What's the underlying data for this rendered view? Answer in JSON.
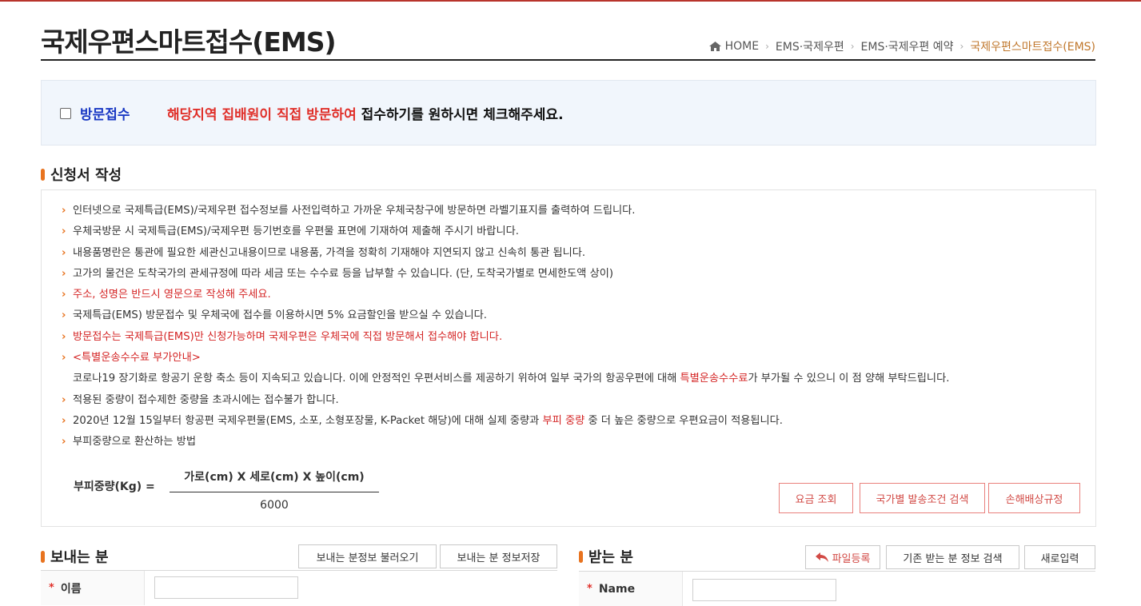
{
  "header": {
    "title": "국제우편스마트접수(EMS)",
    "breadcrumb": {
      "home": "HOME",
      "items": [
        "EMS·국제우편",
        "EMS·국제우편 예약"
      ],
      "current": "국제우편스마트접수(EMS)"
    }
  },
  "visit": {
    "label": "방문접수",
    "desc_red": "해당지역 집배원이 직접 방문하여",
    "desc_rest": " 접수하기를 원하시면 체크해주세요."
  },
  "application": {
    "title": "신청서 작성",
    "items": [
      "인터넷으로 국제특급(EMS)/국제우편 접수정보를 사전입력하고 가까운 우체국창구에 방문하면 라벨기표지를 출력하여 드립니다.",
      "우체국방문 시 국제특급(EMS)/국제우편 등기번호를 우편물 표면에 기재하여 제출해 주시기 바랍니다.",
      "내용품명란은 통관에 필요한 세관신고내용이므로 내용품, 가격을 정확히 기재해야 지연되지 않고 신속히 통관 됩니다.",
      "고가의 물건은 도착국가의 관세규정에 따라 세금 또는 수수료 등을 납부할 수 있습니다. (단, 도착국가별로 면세한도액 상이)",
      "주소, 성명은 반드시 영문으로 작성해 주세요.",
      "국제특급(EMS) 방문접수 및 우체국에 접수를 이용하시면 5% 요금할인을 받으실 수 있습니다.",
      "방문접수는 국제특급(EMS)만 신청가능하며 국제우편은 우체국에 직접 방문해서 접수해야 합니다.",
      "<특별운송수수료 부가안내>"
    ],
    "surcharge": {
      "before": "코로나19 장기화로 항공기 운항 축소 등이 지속되고 있습니다. 이에 안정적인 우편서비스를 제공하기 위하여 일부 국가의 항공우편에 대해 ",
      "red": "특별운송수수료",
      "after": "가 부가될 수 있으니 이 점 양해 부탁드립니다."
    },
    "item_weight_limit": "적용된 중량이 접수제한 중량을 초과시에는 접수불가 합니다.",
    "volume": {
      "before": "2020년 12월 15일부터 항공편 국제우편물(EMS, 소포, 소형포장물, K-Packet 해당)에 대해 실제 중량과 ",
      "red": "부피 중량",
      "after": " 중 더 높은 중량으로 우편요금이 적용됩니다."
    },
    "item_volume_method": "부피중량으로 환산하는 방법",
    "formula": {
      "label": "부피중량(Kg) =",
      "numerator": "가로(cm) X 세로(cm) X 높이(cm)",
      "denominator": "6000"
    },
    "buttons": {
      "fee": "요금 조회",
      "country": "국가별 발송조건 검색",
      "damage": "손해배상규정"
    }
  },
  "sender": {
    "title": "보내는 분",
    "load_button": "보내는 분정보 불러오기",
    "save_button": "보내는 분 정보저장",
    "name_label": "이름",
    "name_value": ""
  },
  "receiver": {
    "title": "받는 분",
    "file_button": "파일등록",
    "search_button": "기존 받는 분 정보 검색",
    "new_button": "새로입력",
    "name_label": "Name",
    "name_value": ""
  },
  "colors": {
    "accent": "#e8731f",
    "red": "#d42424",
    "blue": "#1a39c4",
    "breadcrumb_current": "#c0772c"
  }
}
